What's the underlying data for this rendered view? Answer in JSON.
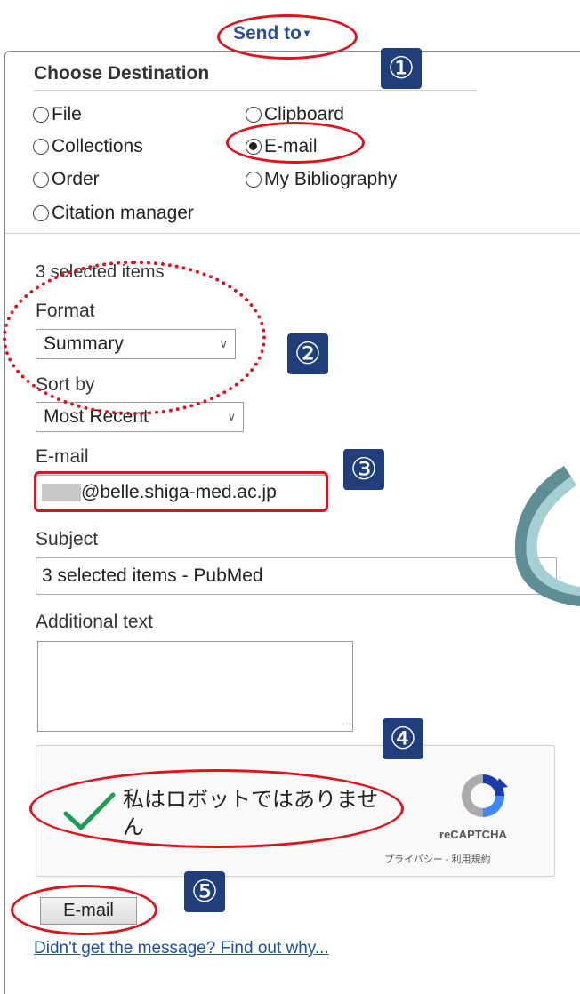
{
  "send_to": {
    "label": "Send to",
    "caret": "▾"
  },
  "choose_destination": {
    "heading": "Choose Destination",
    "options": [
      {
        "label": "File",
        "selected": false
      },
      {
        "label": "Clipboard",
        "selected": false
      },
      {
        "label": "Collections",
        "selected": false
      },
      {
        "label": "E-mail",
        "selected": true
      },
      {
        "label": "Order",
        "selected": false
      },
      {
        "label": "My Bibliography",
        "selected": false
      },
      {
        "label": "Citation manager",
        "selected": false
      }
    ]
  },
  "form": {
    "selected_count": "3 selected items",
    "format_label": "Format",
    "format_value": "Summary",
    "sort_label": "Sort by",
    "sort_value": "Most Recent",
    "email_label": "E-mail",
    "email_value": "@belle.shiga-med.ac.jp",
    "subject_label": "Subject",
    "subject_value": "3 selected items - PubMed",
    "additional_label": "Additional text",
    "additional_value": ""
  },
  "captcha": {
    "text": "私はロボットではありません",
    "brand": "reCAPTCHA",
    "links": "プライバシー - 利用規約"
  },
  "email_button": "E-mail",
  "help_link": "Didn't get the message? Find out why...",
  "step_badges": [
    "①",
    "②",
    "③",
    "④",
    "⑤"
  ],
  "colors": {
    "annotation_red": "#e0131d",
    "badge_blue": "#1f3e7a",
    "link_blue": "#1a4fb0",
    "send_to_blue": "#2a4f9a"
  }
}
